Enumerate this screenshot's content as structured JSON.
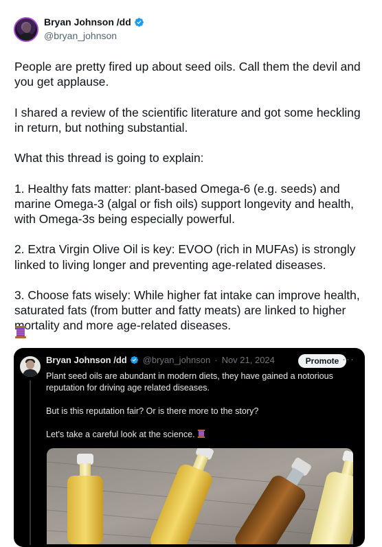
{
  "author": {
    "name": "Bryan Johnson /dd",
    "handle": "@bryan_johnson"
  },
  "tweet": {
    "text": "People are pretty fired up about seed oils. Call them the devil and you get applause.\n\nI shared a review of the scientific literature and got some heckling in return, but nothing substantial.\n\nWhat this thread is going to explain:\n\n1. Healthy fats matter: plant-based Omega-6 (e.g. seeds) and marine Omega-3 (algal or fish oils) support longevity and health, with Omega-3s being especially powerful.\n\n2. Extra Virgin Olive Oil is key: EVOO (rich in MUFAs) is strongly linked to living longer and preventing age-related diseases.\n\n3. Choose fats wisely: While higher fat intake can improve health, saturated fats (from butter and fatty meats) are linked to higher mortality and more age-related diseases.",
    "trailing_icon": "thread-spool-icon"
  },
  "quoted": {
    "name": "Bryan Johnson /dd",
    "handle": "@bryan_johnson",
    "separator": "·",
    "date": "Nov 21, 2024",
    "promote_label": "Promote",
    "more_label": "···",
    "text_p1": "Plant seed oils are abundant in modern diets, they have gained a notorious reputation for driving age related diseases.",
    "text_p2": "But is this reputation fair? Or is there more to the story?",
    "text_p3": "Let's take a careful look at the science.",
    "media_icon": "oil-bottles-photo"
  },
  "colors": {
    "verified": "#1d9bf0",
    "text": "#0f1419",
    "muted": "#536471",
    "card_bg": "#000000"
  }
}
